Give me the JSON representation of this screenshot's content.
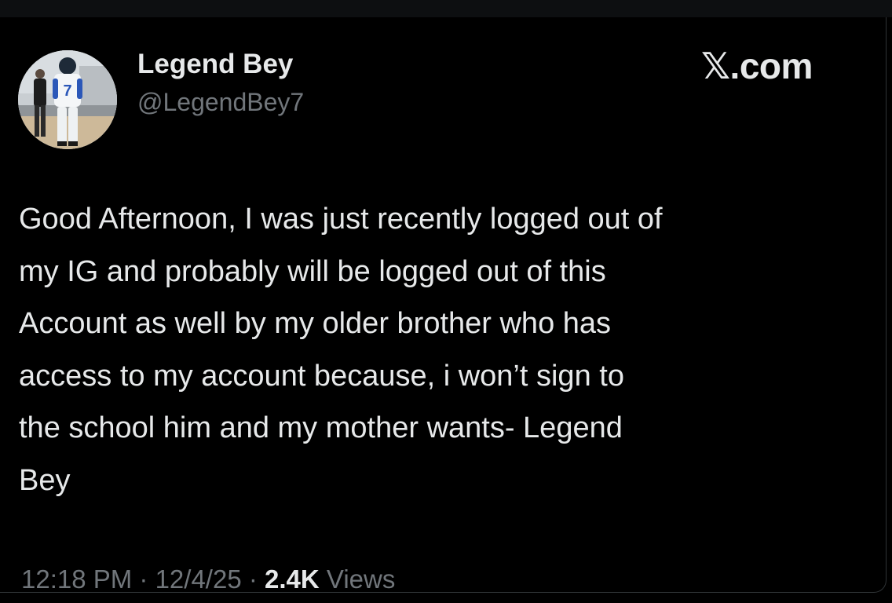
{
  "tweet": {
    "author_name": "Legend Bey",
    "author_handle": "@LegendBey7",
    "brand": "𝕏.com",
    "avatar_jersey_number": "7",
    "text": "Good Afternoon, I was just recently logged out of\nmy IG and probably will be logged out of this\nAccount as well by my older brother who has\naccess to my account because, i won’t sign to\nthe school him and my mother wants- Legend\nBey",
    "time": "12:18 PM",
    "separator": " · ",
    "date": "12/4/25",
    "views_count": "2.4K",
    "views_label": " Views"
  },
  "colors": {
    "background": "#000000",
    "primary_text": "#e7e9ea",
    "secondary_text": "#71767b",
    "border": "#2f3336"
  }
}
